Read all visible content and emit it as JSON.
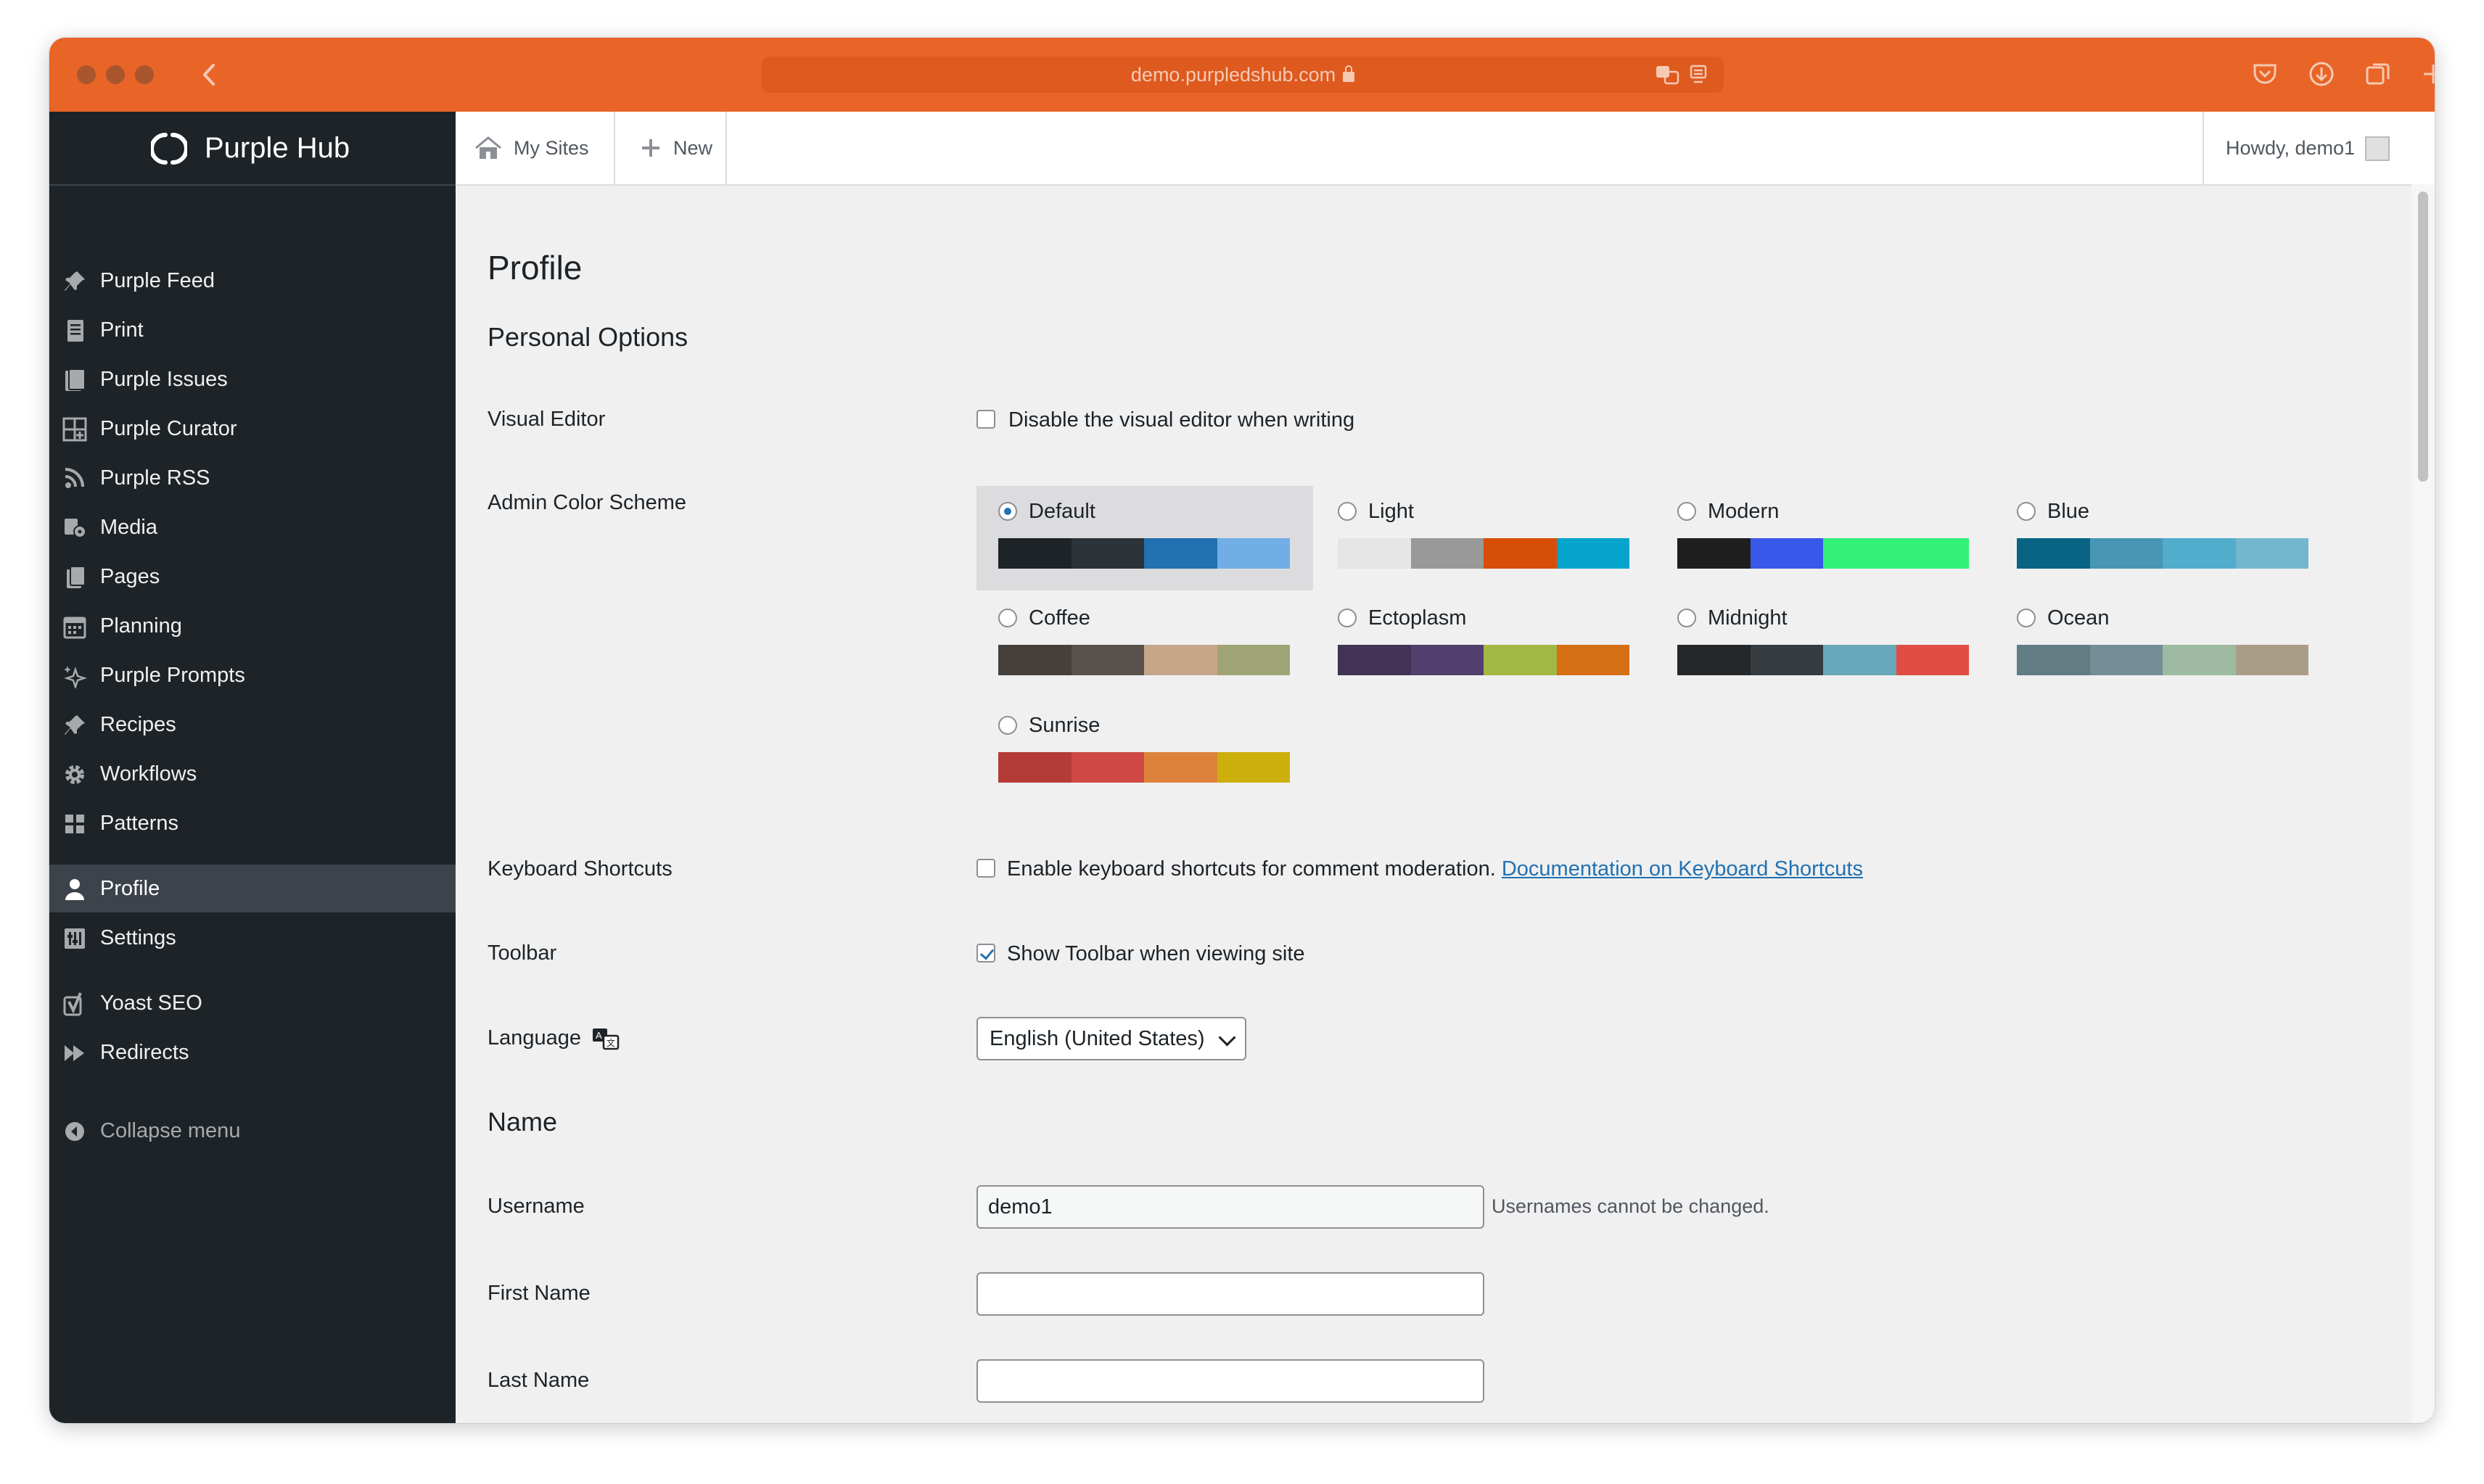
{
  "browser": {
    "url": "demo.purpledshub.com",
    "colors": {
      "chrome": "#e96427",
      "url_bar": "#de5a1f"
    }
  },
  "brand": {
    "name": "Purple Hub"
  },
  "sidebar": {
    "items": [
      {
        "label": "Purple Feed",
        "icon": "pin-icon"
      },
      {
        "label": "Print",
        "icon": "document-icon"
      },
      {
        "label": "Purple Issues",
        "icon": "issues-icon"
      },
      {
        "label": "Purple Curator",
        "icon": "curator-icon"
      },
      {
        "label": "Purple RSS",
        "icon": "rss-icon"
      },
      {
        "label": "Media",
        "icon": "media-icon"
      },
      {
        "label": "Pages",
        "icon": "pages-icon"
      },
      {
        "label": "Planning",
        "icon": "calendar-icon"
      },
      {
        "label": "Purple Prompts",
        "icon": "sparkle-icon"
      },
      {
        "label": "Recipes",
        "icon": "pin-icon"
      },
      {
        "label": "Workflows",
        "icon": "gear-icon"
      },
      {
        "label": "Patterns",
        "icon": "grid-icon"
      },
      {
        "label": "Profile",
        "icon": "user-icon",
        "current": true
      },
      {
        "label": "Settings",
        "icon": "settings-icon"
      },
      {
        "label": "Yoast SEO",
        "icon": "yoast-icon"
      },
      {
        "label": "Redirects",
        "icon": "redirect-icon"
      }
    ],
    "collapse_label": "Collapse menu"
  },
  "adminbar": {
    "my_sites": "My Sites",
    "new": "New",
    "howdy": "Howdy, demo1"
  },
  "page": {
    "title": "Profile",
    "personal_options_heading": "Personal Options",
    "visual_editor": {
      "label": "Visual Editor",
      "checkbox_text": "Disable the visual editor when writing",
      "checked": false
    },
    "color_scheme": {
      "label": "Admin Color Scheme",
      "selected": "Default",
      "schemes": [
        {
          "name": "Default",
          "colors": [
            "#1d2327",
            "#2c3338",
            "#2271b1",
            "#72aee6"
          ]
        },
        {
          "name": "Light",
          "colors": [
            "#e5e5e5",
            "#999999",
            "#d64e07",
            "#04a4cc"
          ]
        },
        {
          "name": "Modern",
          "colors": [
            "#1e1e1e",
            "#3858e9",
            "#33f078",
            "#33f078"
          ]
        },
        {
          "name": "Blue",
          "colors": [
            "#096484",
            "#4796b3",
            "#52accc",
            "#74b6ce"
          ]
        },
        {
          "name": "Coffee",
          "colors": [
            "#46403c",
            "#59524c",
            "#c7a589",
            "#9ea476"
          ]
        },
        {
          "name": "Ectoplasm",
          "colors": [
            "#413256",
            "#523f6d",
            "#a3b745",
            "#d46f15"
          ]
        },
        {
          "name": "Midnight",
          "colors": [
            "#25282b",
            "#363b3f",
            "#69a8bb",
            "#e14d43"
          ]
        },
        {
          "name": "Ocean",
          "colors": [
            "#627c83",
            "#738e96",
            "#9ebaa0",
            "#aa9d88"
          ]
        },
        {
          "name": "Sunrise",
          "colors": [
            "#b43c38",
            "#cf4944",
            "#dd823b",
            "#ccaf0b"
          ]
        }
      ]
    },
    "keyboard_shortcuts": {
      "label": "Keyboard Shortcuts",
      "checkbox_text": "Enable keyboard shortcuts for comment moderation.",
      "link_text": "Documentation on Keyboard Shortcuts",
      "checked": false
    },
    "toolbar": {
      "label": "Toolbar",
      "checkbox_text": "Show Toolbar when viewing site",
      "checked": true
    },
    "language": {
      "label": "Language",
      "value": "English (United States)"
    },
    "name_heading": "Name",
    "username": {
      "label": "Username",
      "value": "demo1",
      "description": "Usernames cannot be changed."
    },
    "first_name": {
      "label": "First Name",
      "value": ""
    },
    "last_name": {
      "label": "Last Name",
      "value": ""
    }
  }
}
